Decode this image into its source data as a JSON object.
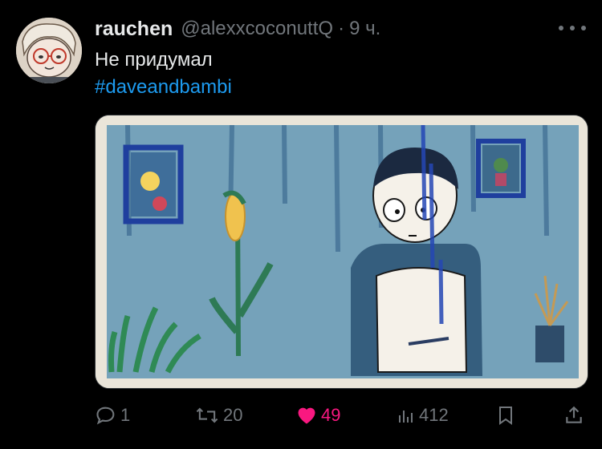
{
  "tweet": {
    "author_name": "rauchen",
    "handle": "@alexxcoconuttQ",
    "separator": "·",
    "time": "9 ч.",
    "text": "Не придумал",
    "hashtag": "#daveandbambi"
  },
  "actions": {
    "replies": "1",
    "retweets": "20",
    "likes": "49",
    "views": "412"
  },
  "icons": [
    "more-icon",
    "reply-icon",
    "retweet-icon",
    "heart-icon",
    "views-icon",
    "bookmark-icon",
    "share-icon"
  ],
  "colors": {
    "link": "#1d9bf0",
    "like": "#f91880",
    "muted": "#71767b",
    "background": "#000000"
  }
}
